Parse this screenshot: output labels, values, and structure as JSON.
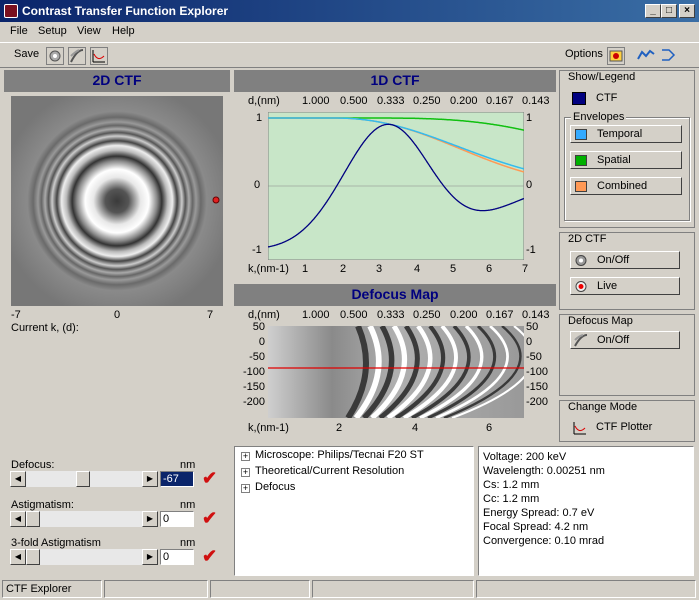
{
  "window": {
    "title": "Contrast Transfer Function Explorer"
  },
  "menu": {
    "items": [
      "File",
      "Setup",
      "View",
      "Help"
    ]
  },
  "toolbar": {
    "save": "Save",
    "options": "Options"
  },
  "panel2d": {
    "title": "2D CTF",
    "ticks": [
      "-7",
      "0",
      "7"
    ],
    "current_k": "Current k, (d):"
  },
  "panel1d": {
    "title": "1D CTF",
    "d_label": "d,(nm)",
    "d_ticks": [
      "1.000",
      "0.500",
      "0.333",
      "0.250",
      "0.200",
      "0.167",
      "0.143"
    ],
    "y_ticks_left": [
      "1",
      "0",
      "-1"
    ],
    "y_ticks_right": [
      "1",
      "0",
      "-1"
    ],
    "k_label": "k,(nm-1)",
    "k_ticks": [
      "1",
      "2",
      "3",
      "4",
      "5",
      "6",
      "7"
    ]
  },
  "defocusmap": {
    "title": "Defocus Map",
    "d_label": "d,(nm)",
    "d_ticks": [
      "1.000",
      "0.500",
      "0.333",
      "0.250",
      "0.200",
      "0.167",
      "0.143"
    ],
    "y_ticks": [
      "50",
      "0",
      "-50",
      "-100",
      "-150",
      "-200"
    ],
    "y_ticks_right": [
      "50",
      "0",
      "-50",
      "-100",
      "-150",
      "-200"
    ],
    "k_label": "k,(nm-1)",
    "k_ticks": [
      "2",
      "4",
      "6"
    ]
  },
  "legend": {
    "title": "Show/Legend",
    "ctf": "CTF",
    "envelopes_title": "Envelopes",
    "temporal": "Temporal",
    "spatial": "Spatial",
    "combined": "Combined",
    "colors": {
      "ctf": "#000080",
      "temporal": "#33aaff",
      "spatial": "#00b000",
      "combined": "#ff9955"
    }
  },
  "ctf2d_group": {
    "title": "2D CTF",
    "onoff": "On/Off",
    "live": "Live"
  },
  "defocus_group": {
    "title": "Defocus Map",
    "onoff": "On/Off"
  },
  "mode_group": {
    "title": "Change Mode",
    "plotter": "CTF Plotter"
  },
  "controls": {
    "defocus": {
      "label": "Defocus:",
      "unit": "nm",
      "value": "-67"
    },
    "astig": {
      "label": "Astigmatism:",
      "unit": "nm",
      "value": "0"
    },
    "astig3": {
      "label": "3-fold Astigmatism",
      "unit": "nm",
      "value": "0"
    }
  },
  "tree": {
    "items": [
      "Microscope: Philips/Tecnai F20 ST",
      "Theoretical/Current Resolution",
      "Defocus"
    ]
  },
  "params": {
    "lines": [
      "Voltage:  200 keV",
      "Wavelength:  0.00251 nm",
      "Cs:  1.2 mm",
      "Cc:  1.2 mm",
      "Energy Spread:  0.7 eV",
      "Focal Spread:  4.2 nm",
      "Convergence:  0.10 mrad"
    ]
  },
  "statusbar": {
    "text": "CTF Explorer"
  }
}
